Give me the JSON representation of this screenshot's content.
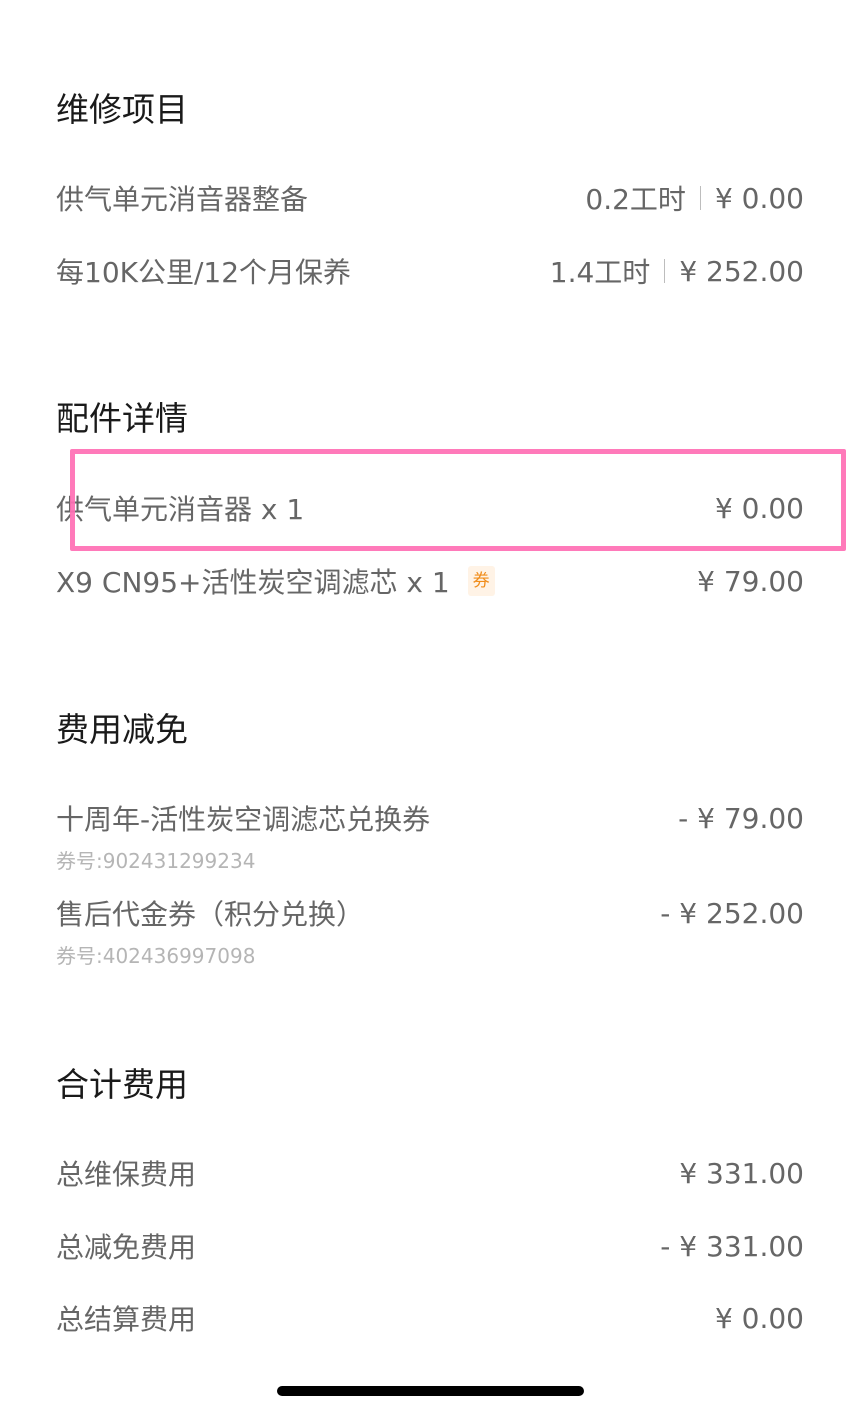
{
  "repair": {
    "title": "维修项目",
    "items": [
      {
        "name": "供气单元消音器整备",
        "hours": "0.2工时",
        "price": "¥ 0.00"
      },
      {
        "name": "每10K公里/12个月保养",
        "hours": "1.4工时",
        "price": "¥ 252.00"
      }
    ]
  },
  "parts": {
    "title": "配件详情",
    "items": [
      {
        "name": "供气单元消音器 x 1",
        "price": "¥ 0.00"
      },
      {
        "name": "X9 CN95+活性炭空调滤芯 x 1",
        "tag": "券",
        "price": "¥ 79.00"
      }
    ]
  },
  "discounts": {
    "title": "费用减免",
    "items": [
      {
        "name": "十周年-活性炭空调滤芯兑换券",
        "code": "券号:902431299234",
        "price": "- ¥ 79.00"
      },
      {
        "name": "售后代金券（积分兑换）",
        "code": "券号:402436997098",
        "price": "- ¥ 252.00"
      }
    ]
  },
  "totals": {
    "title": "合计费用",
    "items": [
      {
        "label": "总维保费用",
        "value": "¥ 331.00"
      },
      {
        "label": "总减免费用",
        "value": "- ¥ 331.00"
      },
      {
        "label": "总结算费用",
        "value": "¥ 0.00"
      }
    ]
  },
  "colors": {
    "highlight": "#ff6fb4",
    "coupon_tag_text": "#f08c1a",
    "coupon_tag_bg": "#fff3e6"
  }
}
